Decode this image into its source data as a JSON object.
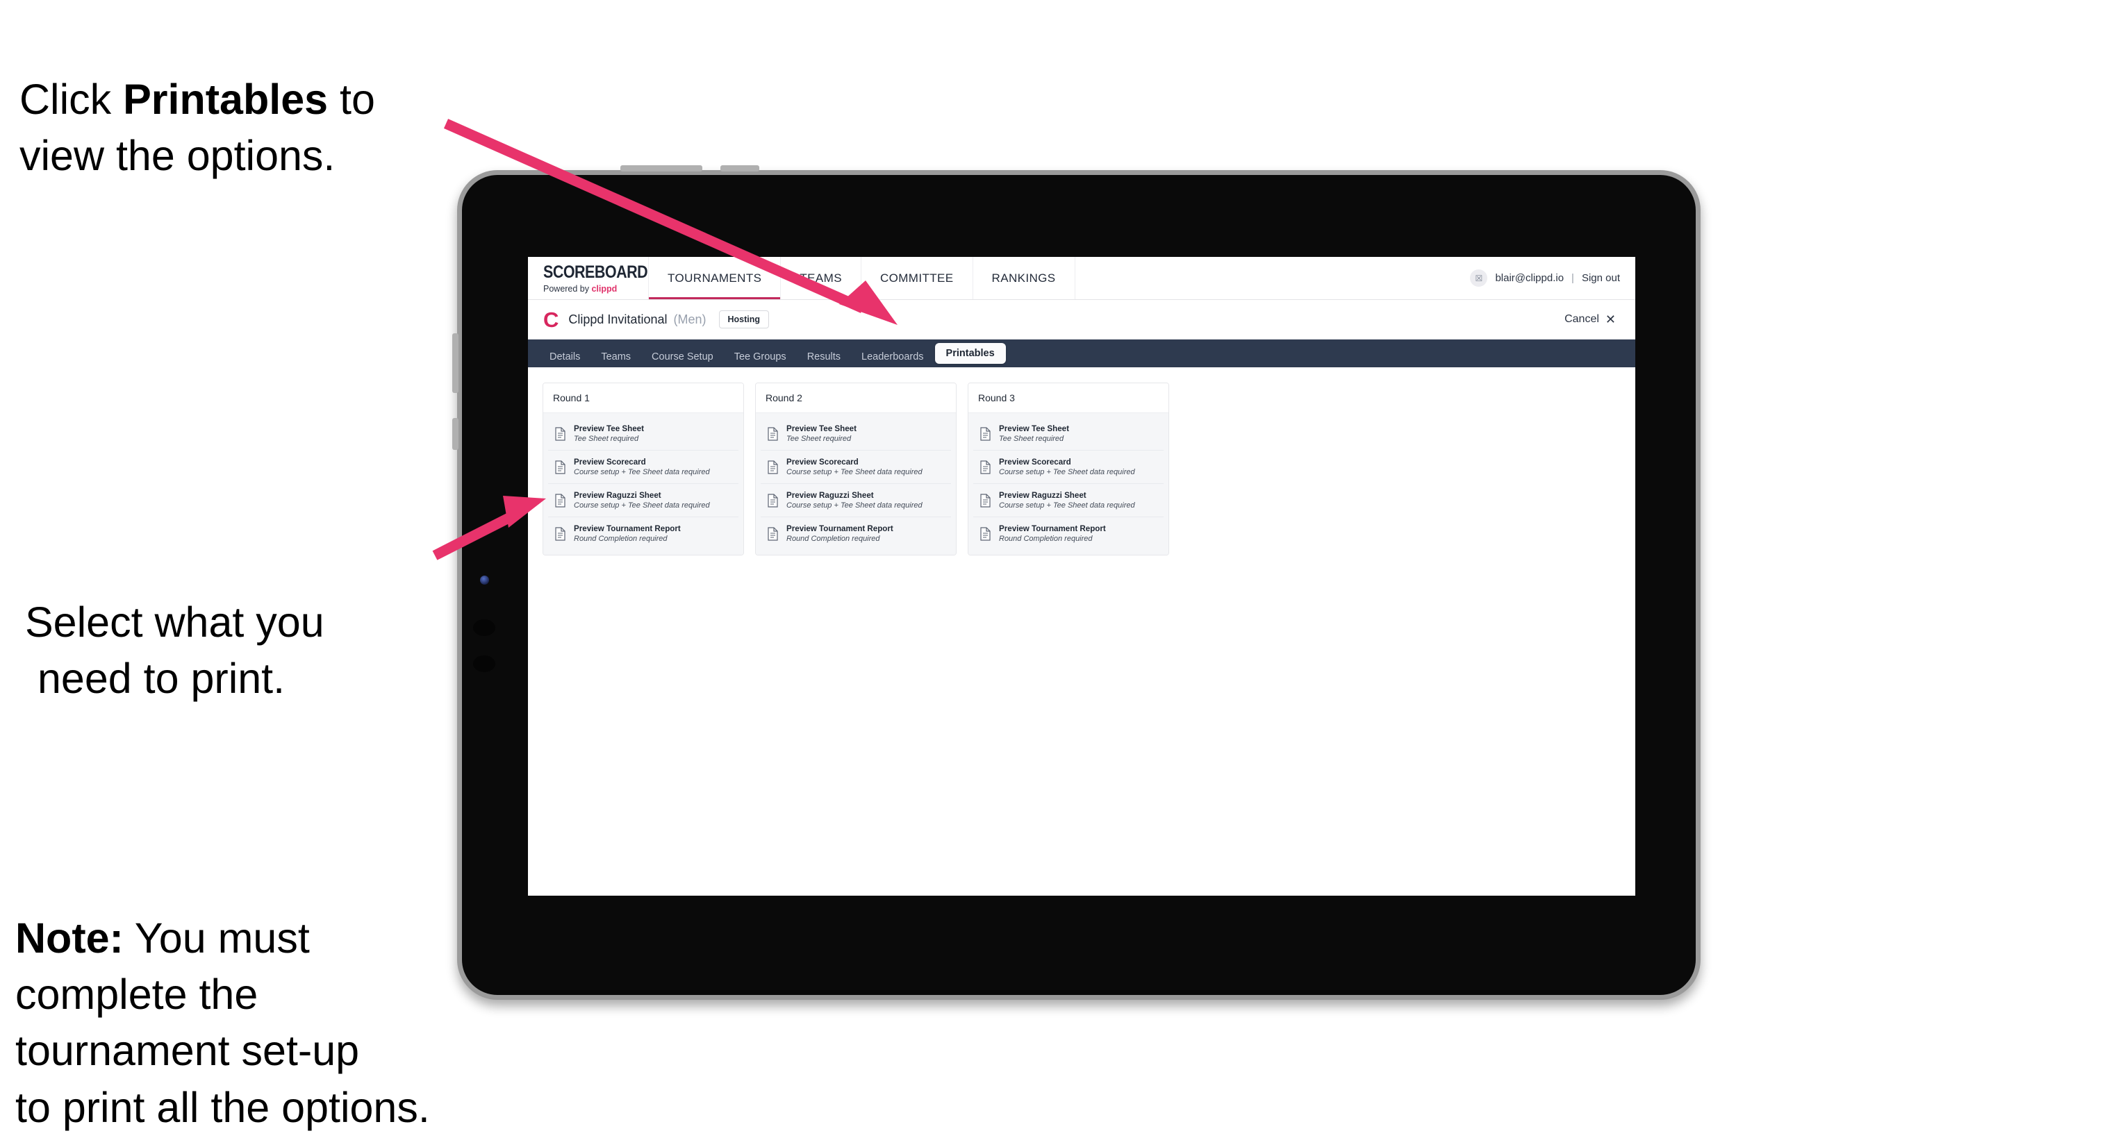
{
  "annotations": {
    "click_printables": {
      "prefix": "Click ",
      "bold": "Printables",
      "suffix": " to\nview the options."
    },
    "select_print_line1": "Select what you",
    "select_print_line2": "need to print.",
    "note": {
      "bold": "Note:",
      "rest": " You must\ncomplete the\ntournament set-up\nto print all the options."
    }
  },
  "colors": {
    "arrow_pink": "#e8336b",
    "brand_pink": "#e0336b",
    "tabbar_dark": "#2e3a4f",
    "clogo_crimson": "#d7265e",
    "active_underline": "#c2295c"
  },
  "app": {
    "brand": {
      "title": "SCOREBOARD",
      "powered_prefix": "Powered by ",
      "powered_brand": "clippd"
    },
    "main_nav": [
      {
        "label": "TOURNAMENTS",
        "active": true
      },
      {
        "label": "TEAMS",
        "active": false
      },
      {
        "label": "COMMITTEE",
        "active": false
      },
      {
        "label": "RANKINGS",
        "active": false
      }
    ],
    "account": {
      "avatar_glyph": "☒",
      "email": "blair@clippd.io",
      "separator": "|",
      "sign_out": "Sign out"
    },
    "tournament": {
      "logo_letter": "C",
      "name": "Clippd Invitational",
      "gender": "(Men)",
      "status_badge": "Hosting",
      "cancel_label": "Cancel",
      "cancel_icon": "✕"
    },
    "tabs": [
      {
        "label": "Details",
        "active": false
      },
      {
        "label": "Teams",
        "active": false
      },
      {
        "label": "Course Setup",
        "active": false
      },
      {
        "label": "Tee Groups",
        "active": false
      },
      {
        "label": "Results",
        "active": false
      },
      {
        "label": "Leaderboards",
        "active": false
      },
      {
        "label": "Printables",
        "active": true
      }
    ],
    "rounds": [
      {
        "title": "Round 1",
        "items": [
          {
            "title": "Preview Tee Sheet",
            "subtitle": "Tee Sheet required"
          },
          {
            "title": "Preview Scorecard",
            "subtitle": "Course setup + Tee Sheet data required"
          },
          {
            "title": "Preview Raguzzi Sheet",
            "subtitle": "Course setup + Tee Sheet data required"
          },
          {
            "title": "Preview Tournament Report",
            "subtitle": "Round Completion required"
          }
        ]
      },
      {
        "title": "Round 2",
        "items": [
          {
            "title": "Preview Tee Sheet",
            "subtitle": "Tee Sheet required"
          },
          {
            "title": "Preview Scorecard",
            "subtitle": "Course setup + Tee Sheet data required"
          },
          {
            "title": "Preview Raguzzi Sheet",
            "subtitle": "Course setup + Tee Sheet data required"
          },
          {
            "title": "Preview Tournament Report",
            "subtitle": "Round Completion required"
          }
        ]
      },
      {
        "title": "Round 3",
        "items": [
          {
            "title": "Preview Tee Sheet",
            "subtitle": "Tee Sheet required"
          },
          {
            "title": "Preview Scorecard",
            "subtitle": "Course setup + Tee Sheet data required"
          },
          {
            "title": "Preview Raguzzi Sheet",
            "subtitle": "Course setup + Tee Sheet data required"
          },
          {
            "title": "Preview Tournament Report",
            "subtitle": "Round Completion required"
          }
        ]
      }
    ]
  }
}
